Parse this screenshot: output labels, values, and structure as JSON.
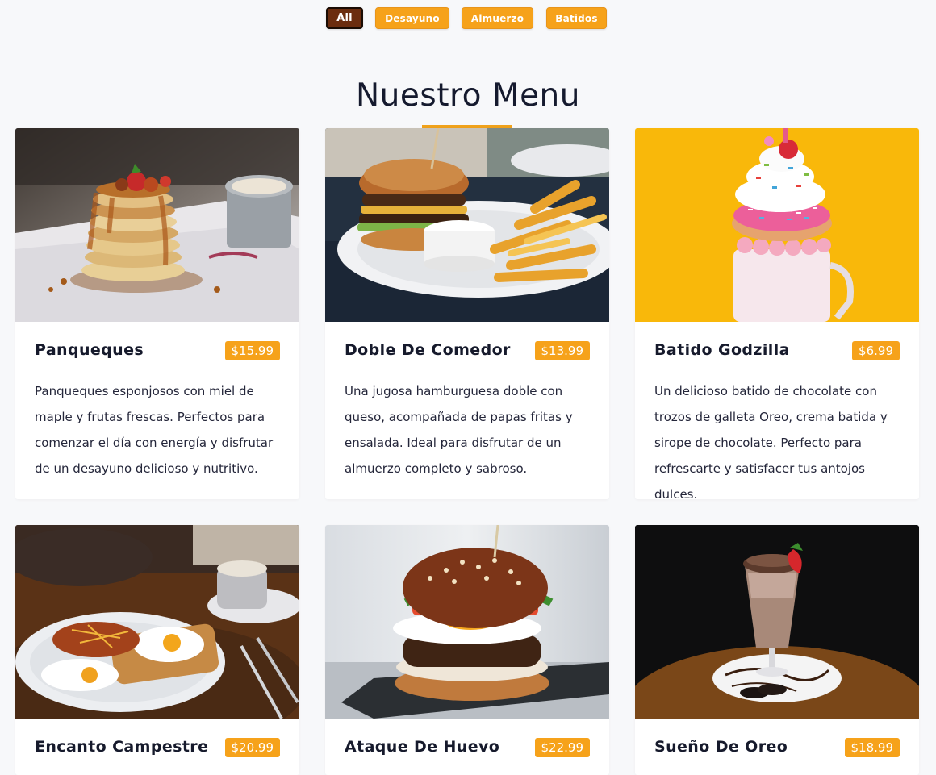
{
  "filters": [
    {
      "label": "All",
      "active": true
    },
    {
      "label": "Desayuno",
      "active": false
    },
    {
      "label": "Almuerzo",
      "active": false
    },
    {
      "label": "Batidos",
      "active": false
    }
  ],
  "section": {
    "title": "Nuestro Menu"
  },
  "items": [
    {
      "name": "Panqueques",
      "price": "$15.99",
      "description": "Panqueques esponjosos con miel de maple y frutas frescas. Perfectos para comenzar el día con energía y disfrutar de un desayuno delicioso y nutritivo.",
      "image": "pancake-stack-photo"
    },
    {
      "name": "Doble De Comedor",
      "price": "$13.99",
      "description": "Una jugosa hamburguesa doble con queso, acompañada de papas fritas y ensalada. Ideal para disfrutar de un almuerzo completo y sabroso.",
      "image": "burger-fries-photo"
    },
    {
      "name": "Batido Godzilla",
      "price": "$6.99",
      "description": "Un delicioso batido de chocolate con trozos de galleta Oreo, crema batida y sirope de chocolate. Perfecto para refrescarte y satisfacer tus antojos dulces.",
      "image": "freakshake-photo"
    },
    {
      "name": "Encanto Campestre",
      "price": "$20.99",
      "image": "country-breakfast-photo"
    },
    {
      "name": "Ataque De Huevo",
      "price": "$22.99",
      "image": "egg-burger-photo"
    },
    {
      "name": "Sueño De Oreo",
      "price": "$18.99",
      "image": "oreo-shake-photo"
    }
  ],
  "colors": {
    "accent": "#f6a21a",
    "active_filter": "#6b2d0f",
    "background": "#f7f8fa"
  }
}
